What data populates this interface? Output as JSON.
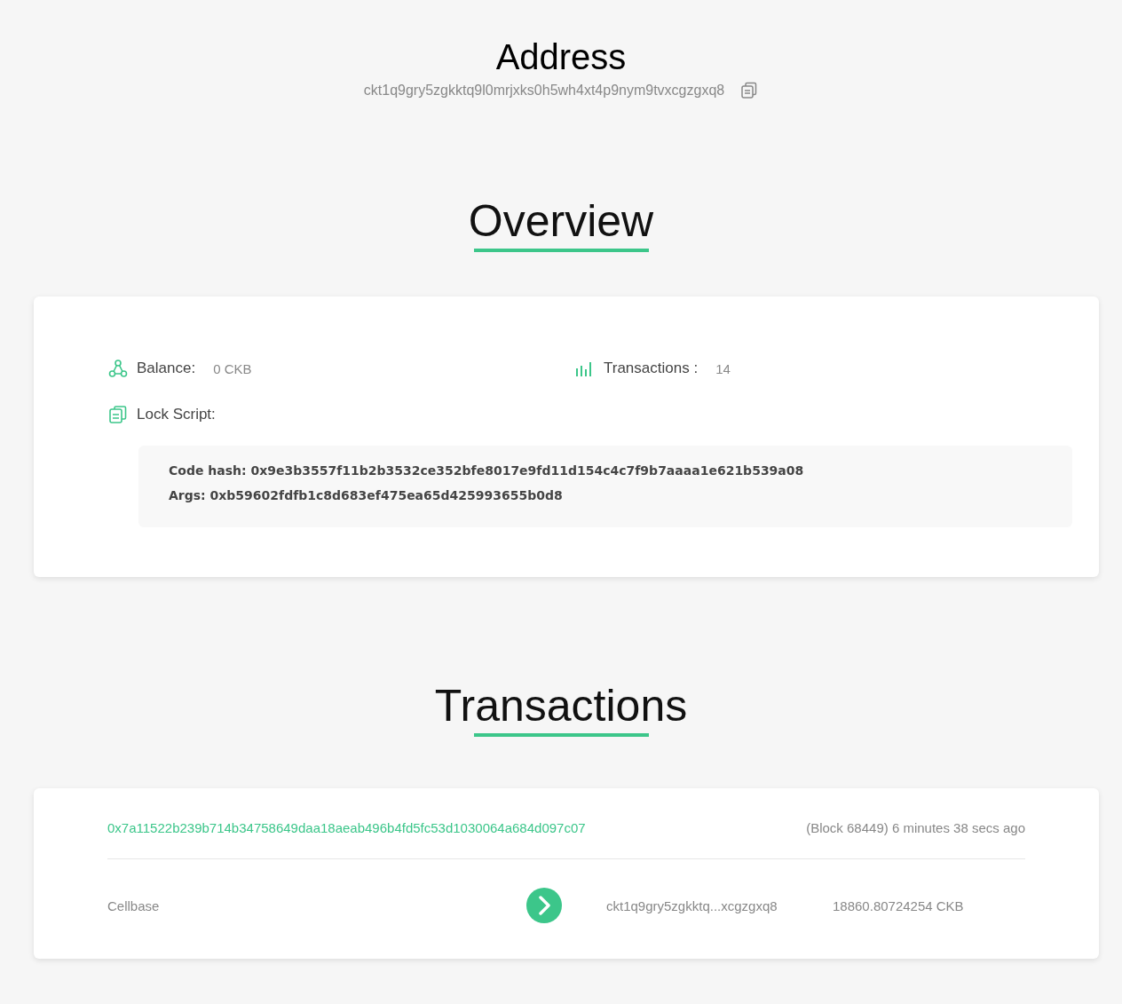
{
  "address": {
    "title": "Address",
    "hash": "ckt1q9gry5zgkktq9l0mrjxks0h5wh4xt4p9nym9tvxcgzgxq8"
  },
  "overview": {
    "heading": "Overview",
    "balance": {
      "label": "Balance:",
      "value": "0 CKB"
    },
    "transactions": {
      "label": "Transactions :",
      "value": "14"
    },
    "lock_script": {
      "label": "Lock Script:",
      "lines": [
        "Code hash: 0x9e3b3557f11b2b3532ce352bfe8017e9fd11d154c4c7f9b7aaaa1e621b539a08",
        "Args: 0xb59602fdfb1c8d683ef475ea65d425993655b0d8"
      ]
    }
  },
  "transactions": {
    "heading": "Transactions",
    "items": [
      {
        "hash": "0x7a11522b239b714b34758649daa18aeab496b4fd5fc53d1030064a684d097c07",
        "info": "(Block 68449) 6 minutes 38 secs ago",
        "input": "Cellbase",
        "output_address": "ckt1q9gry5zgkktq...xcgzgxq8",
        "output_amount": "18860.80724254 CKB"
      }
    ]
  }
}
